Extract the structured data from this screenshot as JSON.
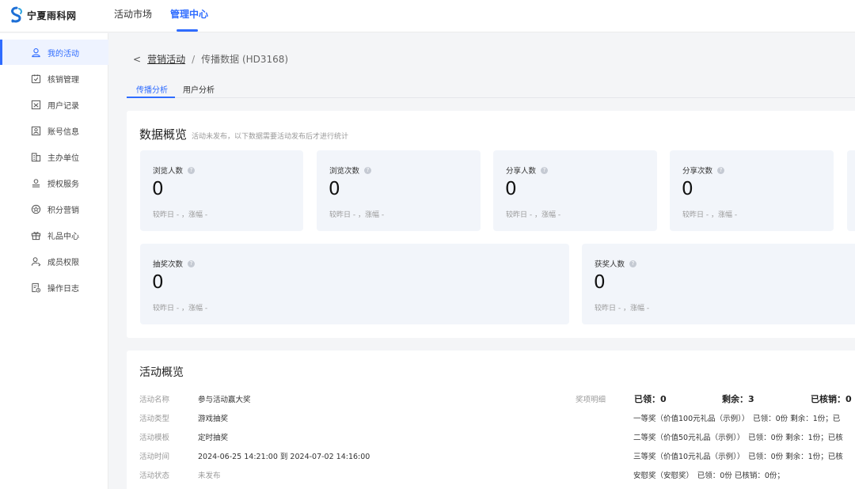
{
  "header": {
    "logo_text": "宁夏雨科网",
    "nav": [
      {
        "label": "活动市场"
      },
      {
        "label": "管理中心"
      }
    ]
  },
  "sidebar": {
    "items": [
      {
        "label": "我的活动",
        "icon": "user-icon"
      },
      {
        "label": "核销管理",
        "icon": "check-square-icon"
      },
      {
        "label": "用户记录",
        "icon": "record-icon"
      },
      {
        "label": "账号信息",
        "icon": "id-card-icon"
      },
      {
        "label": "主办单位",
        "icon": "building-icon"
      },
      {
        "label": "授权服务",
        "icon": "authorize-icon"
      },
      {
        "label": "积分营销",
        "icon": "points-icon"
      },
      {
        "label": "礼品中心",
        "icon": "gift-icon"
      },
      {
        "label": "成员权限",
        "icon": "member-icon"
      },
      {
        "label": "操作日志",
        "icon": "log-icon"
      }
    ]
  },
  "breadcrumb": {
    "back": "<",
    "parent": "营销活动",
    "separator": "/",
    "current": "传播数据 (HD3168)"
  },
  "tabs": [
    {
      "label": "传播分析"
    },
    {
      "label": "用户分析"
    }
  ],
  "overview": {
    "title": "数据概览",
    "subtitle": "活动未发布，以下数据需要活动发布后才进行统计",
    "stats": [
      {
        "label": "浏览人数",
        "value": "0",
        "compare": "较昨日 - ，涨幅 -"
      },
      {
        "label": "浏览次数",
        "value": "0",
        "compare": "较昨日 - ，涨幅 -"
      },
      {
        "label": "分享人数",
        "value": "0",
        "compare": "较昨日 - ，涨幅 -"
      },
      {
        "label": "分享次数",
        "value": "0",
        "compare": "较昨日 - ，涨幅 -"
      },
      {
        "label": "抽奖次数",
        "value": "0",
        "compare": "较昨日 - ，涨幅 -"
      },
      {
        "label": "获奖人数",
        "value": "0",
        "compare": "较昨日 - ，涨幅 -"
      }
    ]
  },
  "activity": {
    "title": "活动概览",
    "rows": [
      {
        "label": "活动名称",
        "value": "参与活动赢大奖"
      },
      {
        "label": "活动类型",
        "value": "游戏抽奖"
      },
      {
        "label": "活动模板",
        "value": "定时抽奖"
      },
      {
        "label": "活动时间",
        "value": "2024-06-25 14:21:00 到 2024-07-02 14:16:00"
      },
      {
        "label": "活动状态",
        "value": "未发布"
      }
    ],
    "prize_label": "奖项明细",
    "prize_summary": {
      "claimed": "已领：0",
      "remaining": "剩余：3",
      "redeemed": "已核销：0"
    },
    "prizes": [
      "一等奖（价值100元礼品（示例））　已领：0份 剩余：1份；已",
      "二等奖（价值50元礼品（示例））　已领：0份 剩余：1份；已核",
      "三等奖（价值10元礼品（示例））　已领：0份 剩余：1份；已核",
      "安慰奖（安慰奖）　已领：0份 已核销：0份；"
    ]
  },
  "colors": {
    "accent": "#2f6cff",
    "stat_bg": "#f2f5fa",
    "page_bg": "#f4f5f7"
  }
}
